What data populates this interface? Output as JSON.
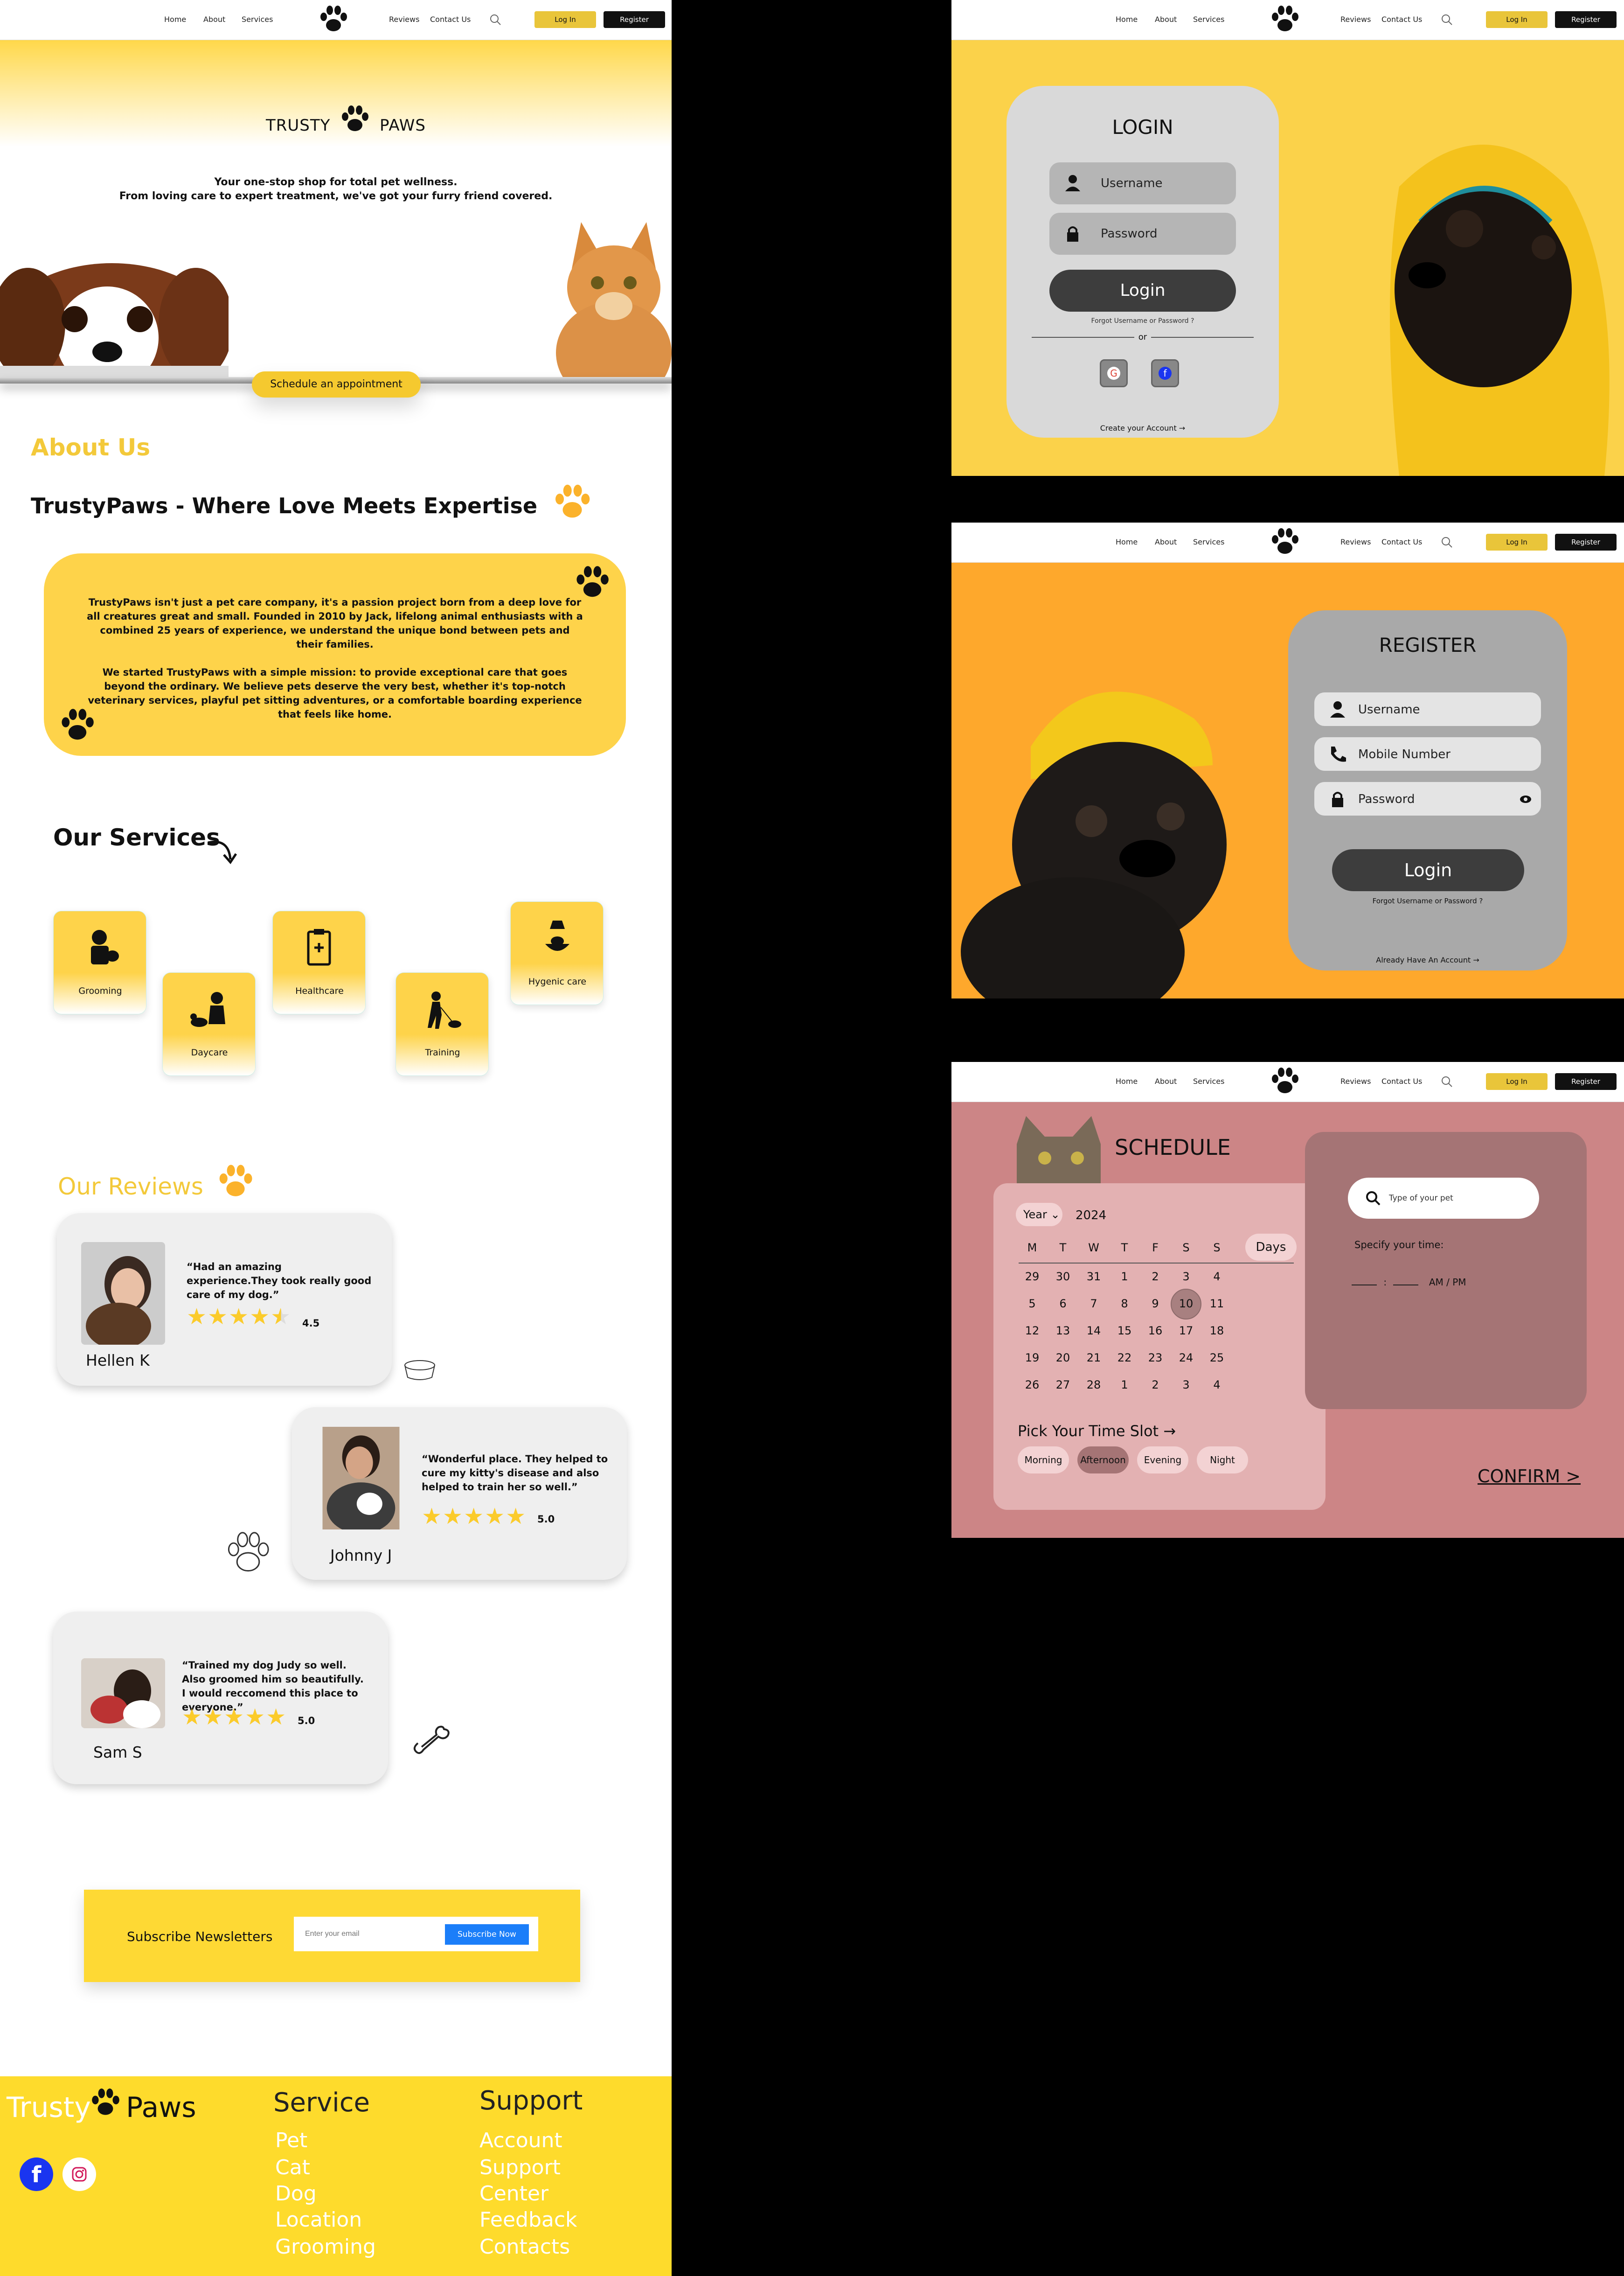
{
  "nav": {
    "home": "Home",
    "about": "About",
    "services": "Services",
    "reviews": "Reviews",
    "contact": "Contact Us",
    "login": "Log In",
    "register": "Register"
  },
  "hero": {
    "brand_left": "TRUSTY",
    "brand_right": "PAWS",
    "line1": "Your one-stop shop for total pet wellness.",
    "line2": "From loving care to expert treatment, we've got your furry friend covered.",
    "appointment": "Schedule an appointment"
  },
  "about": {
    "heading": "About Us",
    "tagline": "TrustyPaws - Where Love Meets Expertise",
    "p1": "TrustyPaws isn't just a pet care company, it's a passion project born from a deep love for all creatures great and small. Founded in 2010 by Jack, lifelong animal enthusiasts with a combined 25 years of experience, we understand the unique bond between pets and their families.",
    "p2": "We started TrustyPaws with a simple mission: to provide exceptional care that goes beyond the ordinary.  We believe pets deserve the very best,  whether it's top-notch veterinary services, playful pet sitting adventures, or a comfortable boarding experience that feels like home."
  },
  "services": {
    "heading": "Our Services",
    "items": [
      {
        "label": "Grooming",
        "icon": "grooming-icon"
      },
      {
        "label": "Daycare",
        "icon": "daycare-icon"
      },
      {
        "label": "Healthcare",
        "icon": "healthcare-icon"
      },
      {
        "label": "Training",
        "icon": "training-icon"
      },
      {
        "label": "Hygenic care",
        "icon": "hygenic-care-icon"
      }
    ]
  },
  "reviews": {
    "heading": "Our Reviews",
    "items": [
      {
        "name": "Hellen K",
        "quote": "“Had an amazing experience.They took really good care of my dog.”",
        "rating": "4.5",
        "stars": 4.5
      },
      {
        "name": "Johnny J",
        "quote": "“Wonderful place. They helped to cure my kitty's disease and also helped to train her so well.”",
        "rating": "5.0",
        "stars": 5
      },
      {
        "name": "Sam S",
        "quote": "“Trained my dog Judy so well. Also groomed him so beautifully. I would reccomend this place to everyone.”",
        "rating": "5.0",
        "stars": 5
      }
    ]
  },
  "newsletter": {
    "title": "Subscribe Newsletters",
    "placeholder": "Enter your email",
    "button": "Subscribe Now"
  },
  "footer": {
    "logo_left": "Trusty",
    "logo_right": "Paws",
    "service_heading": "Service",
    "service_items": [
      "Pet",
      "Cat",
      "Dog",
      "Location",
      "Grooming"
    ],
    "support_heading": "Support",
    "support_items": [
      "Account",
      "Support",
      "Center",
      "Feedback",
      "Contacts"
    ]
  },
  "login": {
    "title": "LOGIN",
    "username": "Username",
    "password": "Password",
    "button": "Login",
    "forgot": "Forgot Username or Password ?",
    "or": "or",
    "create": "Create your Account →"
  },
  "register": {
    "title": "REGISTER",
    "username": "Username",
    "mobile": "Mobile Number",
    "password": "Password",
    "button": "Login",
    "forgot": "Forgot Username or Password ?",
    "already": "Already Have An Account →"
  },
  "schedule": {
    "title": "SCHEDULE",
    "year_label": "Year",
    "year": "2024",
    "days_button": "Days",
    "weekdays": [
      "M",
      "T",
      "W",
      "T",
      "F",
      "S",
      "S"
    ],
    "weeks": [
      [
        "29",
        "30",
        "31",
        "1",
        "2",
        "3",
        "4"
      ],
      [
        "5",
        "6",
        "7",
        "8",
        "9",
        "10",
        "11"
      ],
      [
        "12",
        "13",
        "14",
        "15",
        "16",
        "17",
        "18"
      ],
      [
        "19",
        "20",
        "21",
        "22",
        "23",
        "24",
        "25"
      ],
      [
        "26",
        "27",
        "28",
        "1",
        "2",
        "3",
        "4"
      ]
    ],
    "selected_day": "10",
    "time_slot_heading": "Pick Your Time Slot →",
    "slots": [
      "Morning",
      "Afternoon",
      "Evening",
      "Night"
    ],
    "selected_slot": "Afternoon",
    "search_placeholder": "Type of your pet",
    "specify": "Specify your time:",
    "time_sep": ":",
    "ampm": "AM / PM",
    "confirm": "CONFIRM >"
  },
  "colors": {
    "yellow": "#fed34a",
    "orange": "#fea82c",
    "rose": "#cc8586",
    "blue": "#1b7ef9"
  }
}
